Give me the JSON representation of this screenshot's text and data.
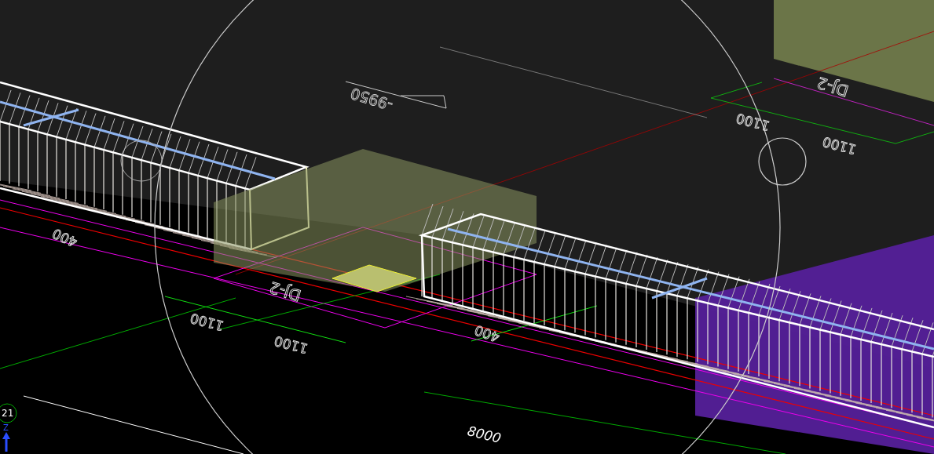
{
  "viewport": {
    "labels": [
      {
        "kind": "elevation",
        "text": "-9950"
      },
      {
        "kind": "dimension",
        "text": "1100"
      },
      {
        "kind": "dimension",
        "text": "1100"
      },
      {
        "kind": "tag",
        "text": "DJ-2"
      },
      {
        "kind": "tag",
        "text": "DJ-2"
      },
      {
        "kind": "dimension",
        "text": "1100"
      },
      {
        "kind": "dimension",
        "text": "1100"
      },
      {
        "kind": "dimension",
        "text": "400"
      },
      {
        "kind": "dimension",
        "text": "400"
      },
      {
        "kind": "overall",
        "text": "8000"
      }
    ]
  },
  "view_cube": {
    "label": "21",
    "axis": "Z"
  }
}
